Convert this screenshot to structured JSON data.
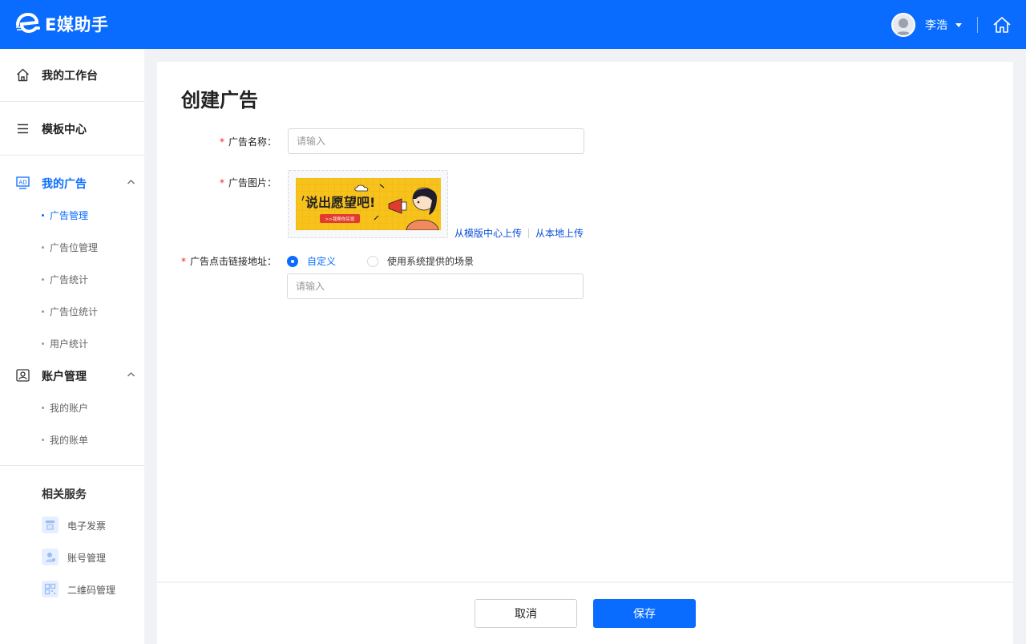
{
  "header": {
    "logo_text": "E媒助手",
    "user_name": "李浩",
    "icons": {
      "logo": "e-logo-icon",
      "avatar": "user-avatar",
      "dropdown": "caret-down-icon",
      "home": "home-icon"
    }
  },
  "sidebar": {
    "top_items": [
      {
        "label": "我的工作台",
        "icon": "home-icon"
      },
      {
        "label": "模板中心",
        "icon": "menu-icon"
      }
    ],
    "groups": [
      {
        "label": "我的广告",
        "icon": "ad-icon",
        "active": true,
        "expanded": true,
        "items": [
          {
            "label": "广告管理",
            "active": true
          },
          {
            "label": "广告位管理",
            "active": false
          },
          {
            "label": "广告统计",
            "active": false
          },
          {
            "label": "广告位统计",
            "active": false
          },
          {
            "label": "用户统计",
            "active": false
          }
        ]
      },
      {
        "label": "账户管理",
        "icon": "account-icon",
        "active": false,
        "expanded": true,
        "items": [
          {
            "label": "我的账户",
            "active": false
          },
          {
            "label": "我的账单",
            "active": false
          }
        ]
      }
    ],
    "services": {
      "title": "相关服务",
      "items": [
        {
          "label": "电子发票",
          "icon": "invoice-icon"
        },
        {
          "label": "账号管理",
          "icon": "user-manage-icon"
        },
        {
          "label": "二维码管理",
          "icon": "qrcode-icon"
        }
      ]
    }
  },
  "form": {
    "title": "创建广告",
    "required_mark": "*",
    "name_label": "广告名称：",
    "name_placeholder": "请输入",
    "name_value": "",
    "image_label": "广告图片：",
    "banner": {
      "headline": "说出愿望吧!",
      "button_text": ">>我帮你实现"
    },
    "upload_template": "从模版中心上传",
    "upload_local": "从本地上传",
    "link_label": "广告点击链接地址：",
    "radio_options": [
      {
        "label": "自定义",
        "checked": true
      },
      {
        "label": "使用系统提供的场景",
        "checked": false
      }
    ],
    "link_placeholder": "请输入",
    "link_value": ""
  },
  "actions": {
    "cancel": "取消",
    "save": "保存"
  },
  "colors": {
    "brand": "#0a6cff",
    "required": "#f5222d",
    "link": "#0a4fd6",
    "banner_bg": "#f7c21b"
  }
}
